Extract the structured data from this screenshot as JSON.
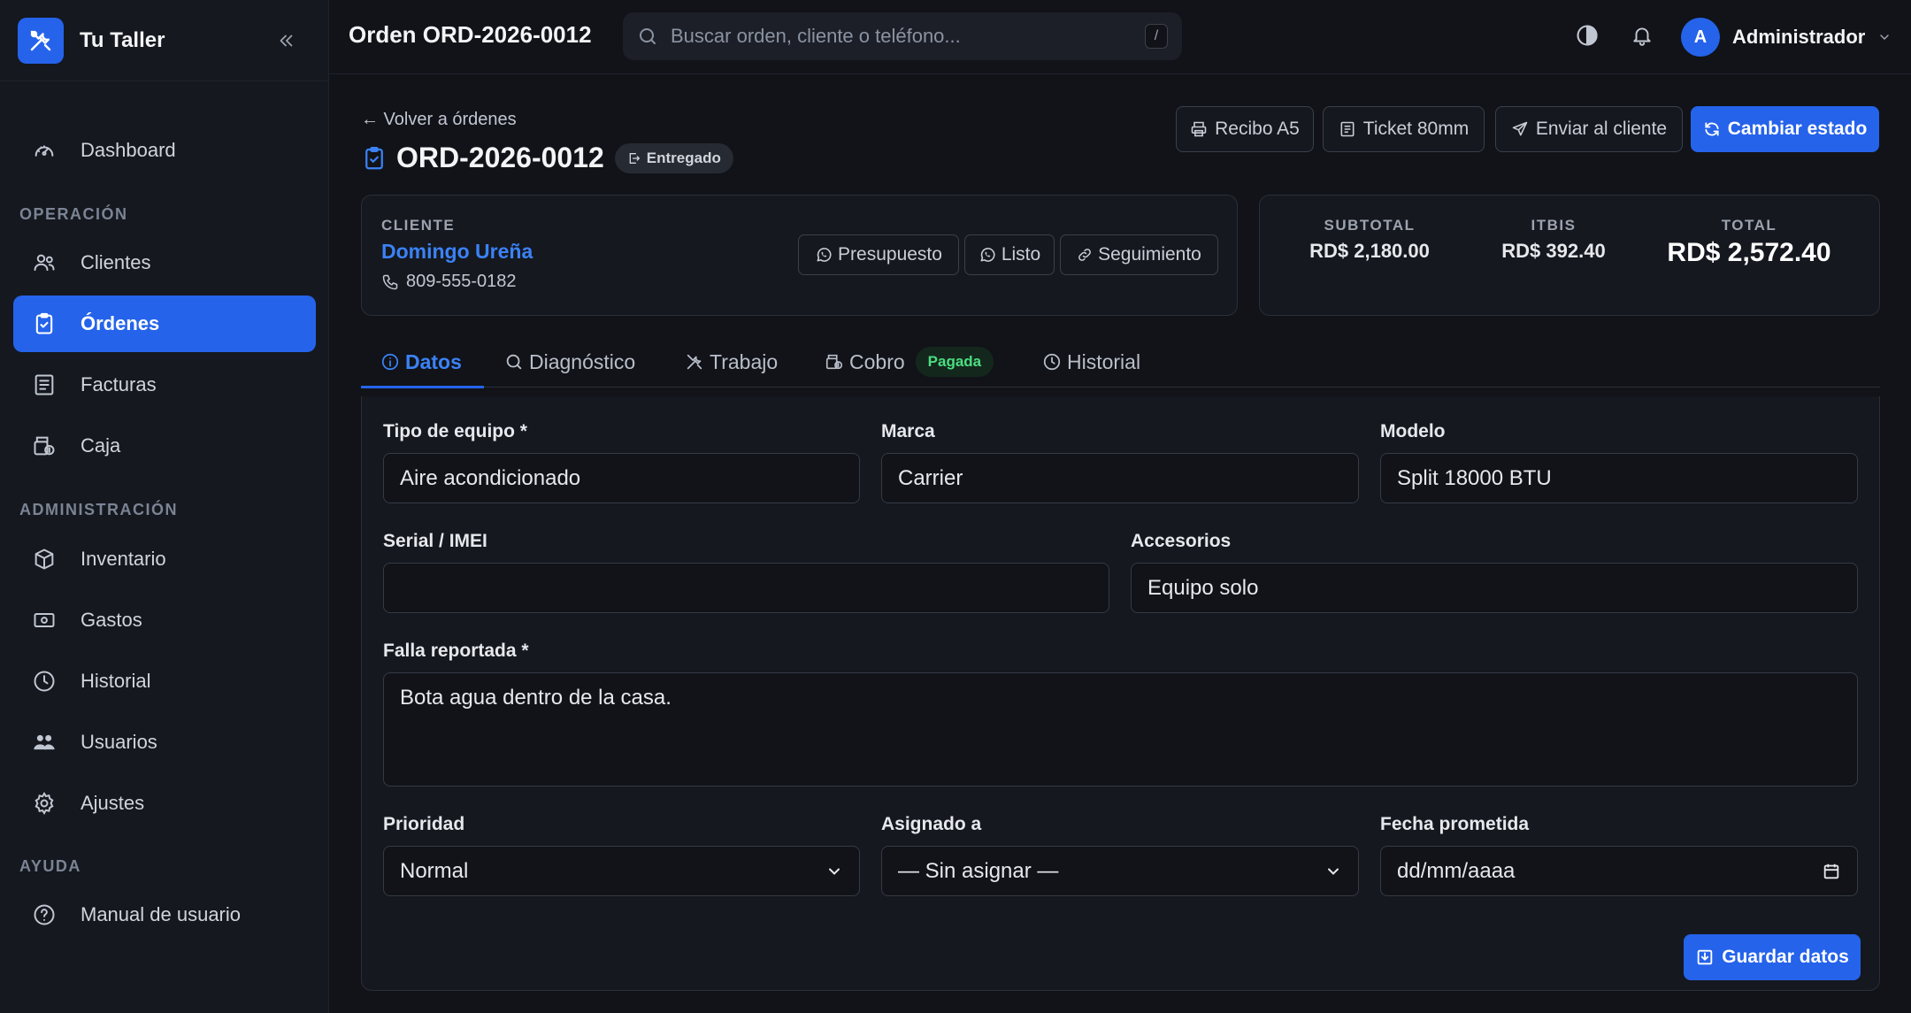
{
  "app": {
    "name": "Tu Taller",
    "accent": "#2563eb"
  },
  "sidebar": {
    "items": [
      {
        "label": "Dashboard",
        "icon": "gauge-icon"
      },
      {
        "label": "Clientes",
        "icon": "users-icon"
      },
      {
        "label": "Órdenes",
        "icon": "clipboard-check-icon",
        "active": true
      },
      {
        "label": "Facturas",
        "icon": "receipt-icon"
      },
      {
        "label": "Caja",
        "icon": "cash-register-icon"
      },
      {
        "label": "Inventario",
        "icon": "box-icon"
      },
      {
        "label": "Gastos",
        "icon": "money-icon"
      },
      {
        "label": "Historial",
        "icon": "clock-icon"
      },
      {
        "label": "Usuarios",
        "icon": "user-group-icon"
      },
      {
        "label": "Ajustes",
        "icon": "gear-icon"
      },
      {
        "label": "Manual de usuario",
        "icon": "help-circle-icon"
      }
    ],
    "sections": {
      "operacion": "OPERACIÓN",
      "administracion": "ADMINISTRACIÓN",
      "ayuda": "AYUDA"
    }
  },
  "topbar": {
    "title": "Orden ORD-2026-0012",
    "search_placeholder": "Buscar orden, cliente o teléfono...",
    "search_shortcut": "/",
    "user_initial": "A",
    "user_name": "Administrador"
  },
  "order": {
    "back_label": "← Volver a órdenes",
    "id": "ORD-2026-0012",
    "status": "Entregado",
    "actions": {
      "receipt_a5": "Recibo A5",
      "ticket_80mm": "Ticket 80mm",
      "send_client": "Enviar al cliente",
      "change_status": "Cambiar estado"
    }
  },
  "client": {
    "label": "CLIENTE",
    "name": "Domingo Ureña",
    "phone": "809-555-0182",
    "buttons": {
      "presupuesto": "Presupuesto",
      "listo": "Listo",
      "seguimiento": "Seguimiento"
    }
  },
  "totals": {
    "subtotal_label": "SUBTOTAL",
    "subtotal": "RD$ 2,180.00",
    "itbis_label": "ITBIS",
    "itbis": "RD$ 392.40",
    "total_label": "TOTAL",
    "total": "RD$ 2,572.40"
  },
  "tabs": {
    "datos": "Datos",
    "diagnostico": "Diagnóstico",
    "trabajo": "Trabajo",
    "cobro": "Cobro",
    "cobro_badge": "Pagada",
    "historial": "Historial"
  },
  "form": {
    "tipo_label": "Tipo de equipo *",
    "tipo_value": "Aire acondicionado",
    "marca_label": "Marca",
    "marca_value": "Carrier",
    "modelo_label": "Modelo",
    "modelo_value": "Split 18000 BTU",
    "serial_label": "Serial / IMEI",
    "serial_value": "",
    "accesorios_label": "Accesorios",
    "accesorios_value": "Equipo solo",
    "falla_label": "Falla reportada *",
    "falla_value": "Bota agua dentro de la casa.",
    "prioridad_label": "Prioridad",
    "prioridad_value": "Normal",
    "asignado_label": "Asignado a",
    "asignado_value": "— Sin asignar —",
    "fecha_label": "Fecha prometida",
    "fecha_value": "dd/mm/aaaa",
    "save_label": "Guardar datos"
  }
}
